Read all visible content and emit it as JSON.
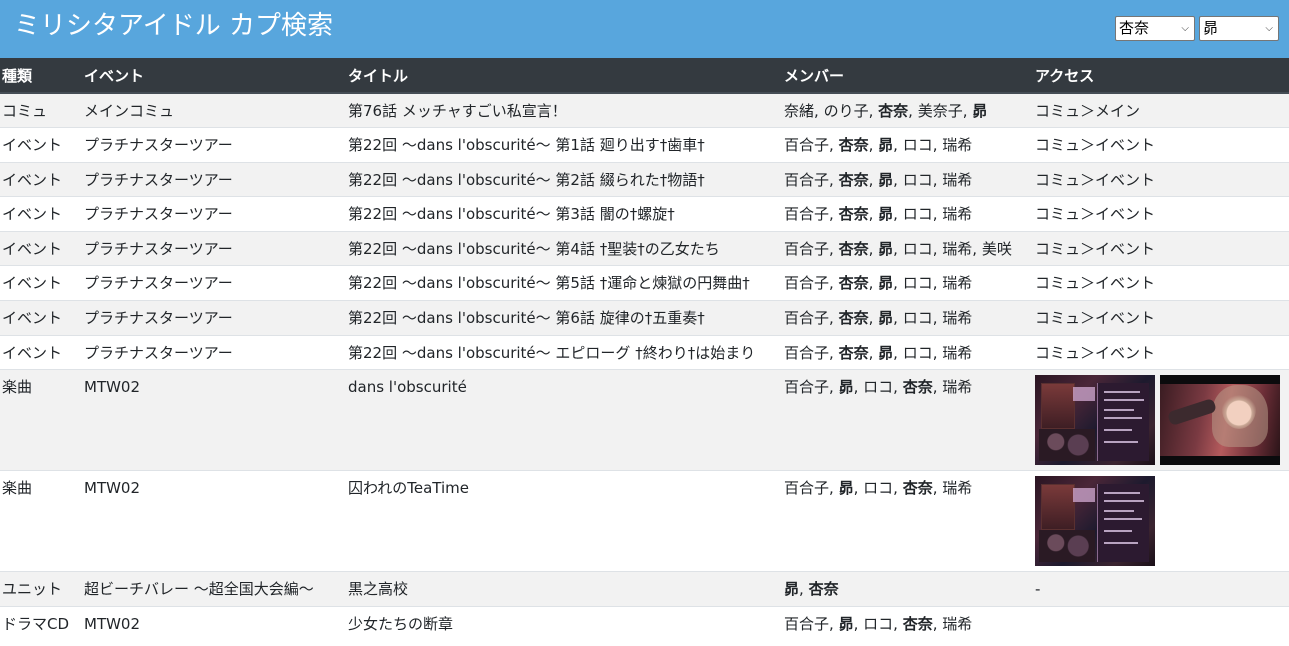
{
  "header": {
    "title": "ミリシタアイドル カプ検索",
    "select_a": "杏奈",
    "select_b": "昴",
    "background_color": "#58a6dd"
  },
  "table": {
    "columns": [
      "種類",
      "イベント",
      "タイトル",
      "メンバー",
      "アクセス"
    ],
    "rows": [
      {
        "type": "コミュ",
        "event": "メインコミュ",
        "title": "第76話 メッチャすごい私宣言！",
        "members": [
          {
            "name": "奈緒",
            "bold": false
          },
          {
            "name": "のり子",
            "bold": false
          },
          {
            "name": "杏奈",
            "bold": true
          },
          {
            "name": "美奈子",
            "bold": false
          },
          {
            "name": "昴",
            "bold": true
          }
        ],
        "access": "コミュ＞メイン"
      },
      {
        "type": "イベント",
        "event": "プラチナスターツアー",
        "title": "第22回 ～dans l'obscurité～ 第1話 廻り出す†歯車†",
        "members": [
          {
            "name": "百合子",
            "bold": false
          },
          {
            "name": "杏奈",
            "bold": true
          },
          {
            "name": "昴",
            "bold": true
          },
          {
            "name": "ロコ",
            "bold": false
          },
          {
            "name": "瑞希",
            "bold": false
          }
        ],
        "access": "コミュ＞イベント"
      },
      {
        "type": "イベント",
        "event": "プラチナスターツアー",
        "title": "第22回 ～dans l'obscurité～ 第2話 綴られた†物語†",
        "members": [
          {
            "name": "百合子",
            "bold": false
          },
          {
            "name": "杏奈",
            "bold": true
          },
          {
            "name": "昴",
            "bold": true
          },
          {
            "name": "ロコ",
            "bold": false
          },
          {
            "name": "瑞希",
            "bold": false
          }
        ],
        "access": "コミュ＞イベント"
      },
      {
        "type": "イベント",
        "event": "プラチナスターツアー",
        "title": "第22回 ～dans l'obscurité～ 第3話 闇の†螺旋†",
        "members": [
          {
            "name": "百合子",
            "bold": false
          },
          {
            "name": "杏奈",
            "bold": true
          },
          {
            "name": "昴",
            "bold": true
          },
          {
            "name": "ロコ",
            "bold": false
          },
          {
            "name": "瑞希",
            "bold": false
          }
        ],
        "access": "コミュ＞イベント"
      },
      {
        "type": "イベント",
        "event": "プラチナスターツアー",
        "title": "第22回 ～dans l'obscurité～ 第4話 †聖装†の乙女たち",
        "members": [
          {
            "name": "百合子",
            "bold": false
          },
          {
            "name": "杏奈",
            "bold": true
          },
          {
            "name": "昴",
            "bold": true
          },
          {
            "name": "ロコ",
            "bold": false
          },
          {
            "name": "瑞希",
            "bold": false
          },
          {
            "name": "美咲",
            "bold": false
          }
        ],
        "access": "コミュ＞イベント"
      },
      {
        "type": "イベント",
        "event": "プラチナスターツアー",
        "title": "第22回 ～dans l'obscurité～ 第5話 †運命と煉獄の円舞曲†",
        "members": [
          {
            "name": "百合子",
            "bold": false
          },
          {
            "name": "杏奈",
            "bold": true
          },
          {
            "name": "昴",
            "bold": true
          },
          {
            "name": "ロコ",
            "bold": false
          },
          {
            "name": "瑞希",
            "bold": false
          }
        ],
        "access": "コミュ＞イベント"
      },
      {
        "type": "イベント",
        "event": "プラチナスターツアー",
        "title": "第22回 ～dans l'obscurité～ 第6話 旋律の†五重奏†",
        "members": [
          {
            "name": "百合子",
            "bold": false
          },
          {
            "name": "杏奈",
            "bold": true
          },
          {
            "name": "昴",
            "bold": true
          },
          {
            "name": "ロコ",
            "bold": false
          },
          {
            "name": "瑞希",
            "bold": false
          }
        ],
        "access": "コミュ＞イベント"
      },
      {
        "type": "イベント",
        "event": "プラチナスターツアー",
        "title": "第22回 ～dans l'obscurité～ エピローグ †終わり†は始まり",
        "members": [
          {
            "name": "百合子",
            "bold": false
          },
          {
            "name": "杏奈",
            "bold": true
          },
          {
            "name": "昴",
            "bold": true
          },
          {
            "name": "ロコ",
            "bold": false
          },
          {
            "name": "瑞希",
            "bold": false
          }
        ],
        "access": "コミュ＞イベント"
      },
      {
        "type": "楽曲",
        "event": "MTW02",
        "title": "dans l'obscurité",
        "members": [
          {
            "name": "百合子",
            "bold": false
          },
          {
            "name": "昴",
            "bold": true
          },
          {
            "name": "ロコ",
            "bold": false
          },
          {
            "name": "杏奈",
            "bold": true
          },
          {
            "name": "瑞希",
            "bold": false
          }
        ],
        "access": "",
        "thumbs": [
          "cd-jacket-thumbnail",
          "video-thumbnail"
        ]
      },
      {
        "type": "楽曲",
        "event": "MTW02",
        "title": "囚われのTeaTime",
        "members": [
          {
            "name": "百合子",
            "bold": false
          },
          {
            "name": "昴",
            "bold": true
          },
          {
            "name": "ロコ",
            "bold": false
          },
          {
            "name": "杏奈",
            "bold": true
          },
          {
            "name": "瑞希",
            "bold": false
          }
        ],
        "access": "",
        "thumbs": [
          "cd-jacket-thumbnail"
        ]
      },
      {
        "type": "ユニット",
        "event": "超ビーチバレー ～超全国大会編～",
        "title": "黒之高校",
        "members": [
          {
            "name": "昴",
            "bold": true
          },
          {
            "name": "杏奈",
            "bold": true
          }
        ],
        "access": "-"
      },
      {
        "type": "ドラマCD",
        "event": "MTW02",
        "title": "少女たちの断章",
        "members": [
          {
            "name": "百合子",
            "bold": false
          },
          {
            "name": "昴",
            "bold": true
          },
          {
            "name": "ロコ",
            "bold": false
          },
          {
            "name": "杏奈",
            "bold": true
          },
          {
            "name": "瑞希",
            "bold": false
          }
        ],
        "access": ""
      }
    ]
  }
}
